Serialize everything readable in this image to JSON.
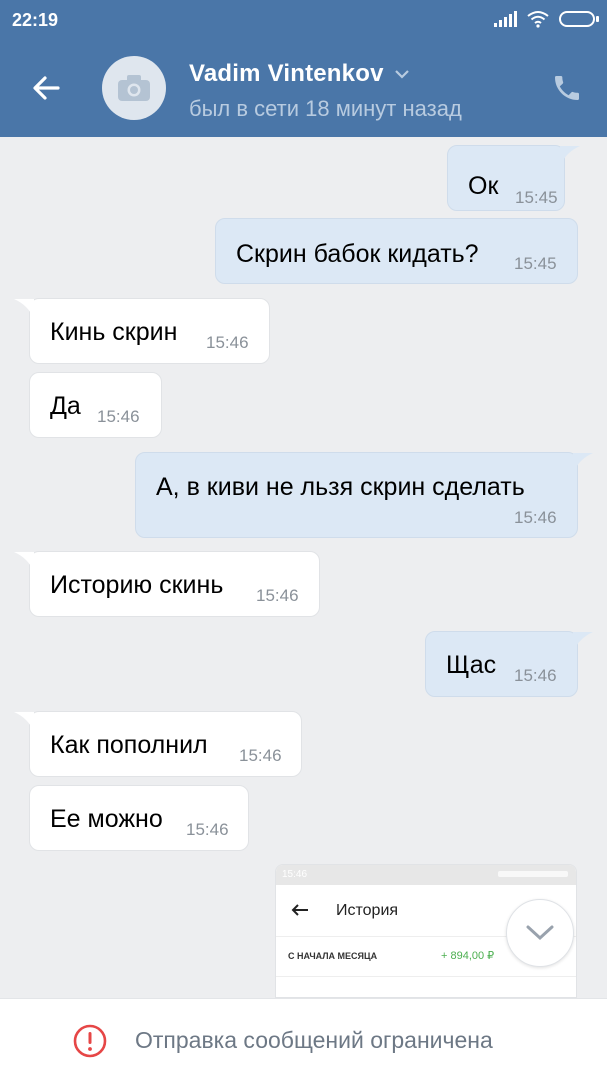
{
  "status_bar": {
    "time": "22:19"
  },
  "header": {
    "title": "Vadim Vintenkov",
    "subtitle": "был в сети 18 минут назад"
  },
  "messages": [
    {
      "dir": "out",
      "text": "Ок",
      "time": "15:45"
    },
    {
      "dir": "out",
      "text": "Скрин бабок кидать?",
      "time": "15:45"
    },
    {
      "dir": "in",
      "text": "Кинь скрин",
      "time": "15:46"
    },
    {
      "dir": "in",
      "text": "Да",
      "time": "15:46"
    },
    {
      "dir": "out",
      "text": "А, в киви не льзя скрин сделать",
      "time": "15:46"
    },
    {
      "dir": "in",
      "text": "Историю скинь",
      "time": "15:46"
    },
    {
      "dir": "out",
      "text": "Щас",
      "time": "15:46"
    },
    {
      "dir": "in",
      "text": "Как пополнил",
      "time": "15:46"
    },
    {
      "dir": "in",
      "text": "Ее можно",
      "time": "15:46"
    }
  ],
  "attachment": {
    "status_time": "15:46",
    "title": "История",
    "row_label": "С НАЧАЛА МЕСЯЦА",
    "row_amount": "+ 894,00 ₽"
  },
  "footer": {
    "text": "Отправка сообщений ограничена"
  },
  "colors": {
    "accent": "#4a76a8",
    "warning": "#e64646"
  }
}
